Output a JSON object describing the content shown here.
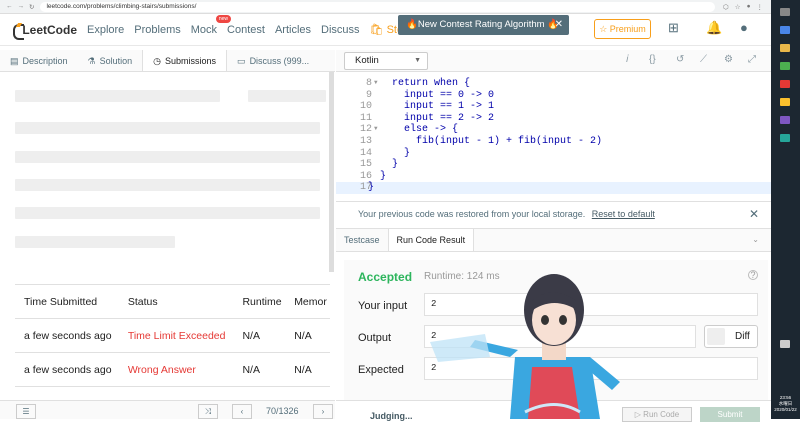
{
  "browser": {
    "url": "leetcode.com/problems/climbing-stairs/submissions/",
    "nav_icons": [
      "back-icon",
      "forward-icon",
      "reload-icon"
    ]
  },
  "nav": {
    "logo": "LeetCode",
    "links": [
      "Explore",
      "Problems",
      "Mock",
      "Contest",
      "Articles",
      "Discuss",
      "Store"
    ],
    "mock_badge": "new",
    "toast": "New Contest Rating Algorithm",
    "premium": "Premium"
  },
  "tabs": [
    "Description",
    "Solution",
    "Submissions",
    "Discuss (999..."
  ],
  "active_tab": "Submissions",
  "editor": {
    "language": "Kotlin",
    "lines": [
      {
        "n": "8",
        "fold": true,
        "code": "return when {"
      },
      {
        "n": "9",
        "fold": false,
        "code": "    input == 0 -> 0"
      },
      {
        "n": "10",
        "fold": false,
        "code": "    input == 1 -> 1"
      },
      {
        "n": "11",
        "fold": false,
        "code": "    input == 2 -> 2"
      },
      {
        "n": "12",
        "fold": true,
        "code": "    else -> {"
      },
      {
        "n": "13",
        "fold": false,
        "code": "        fib(input - 1) + fib(input - 2)"
      },
      {
        "n": "14",
        "fold": false,
        "code": "    }"
      },
      {
        "n": "15",
        "fold": false,
        "code": "}"
      },
      {
        "n": "16",
        "fold": false,
        "code": "}"
      },
      {
        "n": "17",
        "fold": false,
        "code": "}"
      }
    ]
  },
  "restore": {
    "message": "Your previous code was restored from your local storage.",
    "link": "Reset to default"
  },
  "result_tabs": [
    "Testcase",
    "Run Code Result"
  ],
  "result": {
    "status": "Accepted",
    "runtime": "Runtime: 124 ms",
    "input_label": "Your input",
    "input": "2",
    "output_label": "Output",
    "output": "2",
    "expected_label": "Expected",
    "expected": "2",
    "diff": "Diff"
  },
  "submissions": {
    "headers": [
      "Time Submitted",
      "Status",
      "Runtime",
      "Memor"
    ],
    "rows": [
      {
        "time": "a few seconds ago",
        "status": "Time Limit Exceeded",
        "runtime": "N/A",
        "memory": "N/A"
      },
      {
        "time": "a few seconds ago",
        "status": "Wrong Answer",
        "runtime": "N/A",
        "memory": "N/A"
      }
    ]
  },
  "pager": {
    "text": "70/1326"
  },
  "bottom": {
    "judging": "Judging...",
    "run": "Run Code",
    "submit": "Submit"
  },
  "clock": {
    "time": "23:56",
    "day": "水曜日",
    "date": "2020/01/22"
  },
  "colors": {
    "accepted": "#2db55d",
    "error": "#e53935",
    "brand": "#f89f1b"
  }
}
